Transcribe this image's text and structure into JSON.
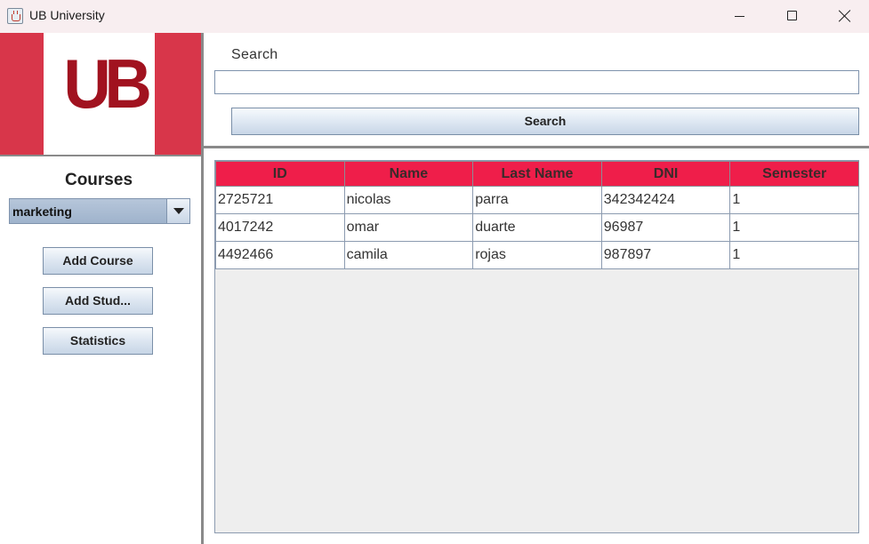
{
  "window": {
    "title": "UB University"
  },
  "logo": {
    "text": "UB"
  },
  "sidebar": {
    "courses_title": "Courses",
    "course_select": {
      "selected": "marketing"
    },
    "buttons": {
      "add_course": "Add Course",
      "add_student": "Add Stud...",
      "statistics": "Statistics"
    }
  },
  "search": {
    "label": "Search",
    "value": "",
    "button_label": "Search"
  },
  "table": {
    "headers": [
      "ID",
      "Name",
      "Last Name",
      "DNI",
      "Semester"
    ],
    "rows": [
      [
        "2725721",
        "nicolas",
        "parra",
        "342342424",
        "1"
      ],
      [
        "4017242",
        "omar",
        "duarte",
        "96987",
        "1"
      ],
      [
        "4492466",
        "camila",
        "rojas",
        "987897",
        "1"
      ]
    ]
  },
  "colors": {
    "header_bg": "#ef1e4a",
    "logo_bg": "#d8364a",
    "logo_text": "#a1121f"
  }
}
